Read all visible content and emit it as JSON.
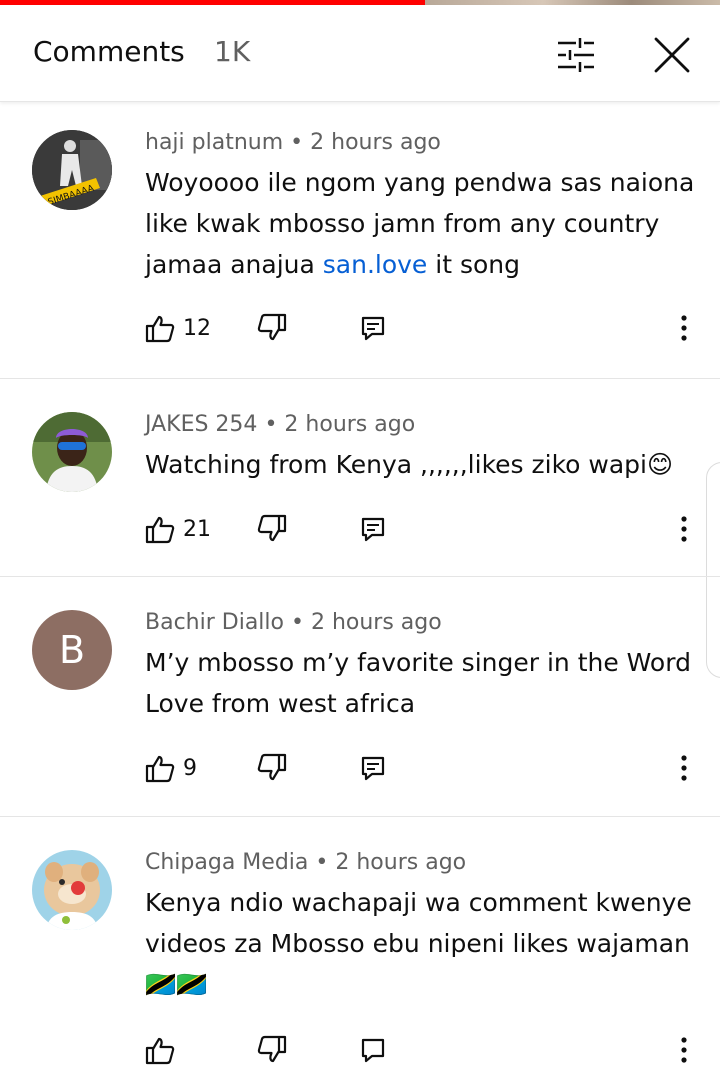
{
  "header": {
    "title": "Comments",
    "count": "1K"
  },
  "comments": [
    {
      "author": "haji platnum",
      "time": "2 hours ago",
      "text_before": "Woyoooo ile ngom yang pendwa sas naiona like kwak mbosso jamn from any country jamaa anajua ",
      "link": "san.love",
      "text_after": " it song",
      "likes": "12",
      "avatar_text": "SIMBAAAA"
    },
    {
      "author": "JAKES 254",
      "time": "2 hours ago",
      "text": "Watching from Kenya ,,,,,,likes ziko wapi😊",
      "likes": "21"
    },
    {
      "author": "Bachir Diallo",
      "time": "2 hours ago",
      "text": "M’y mbosso m’y favorite singer in the Word Love from west africa",
      "likes": "9",
      "avatar_letter": "B"
    },
    {
      "author": "Chipaga Media",
      "time": "2 hours ago",
      "text": "Kenya ndio wachapaji wa comment kwenye videos za Mbosso ebu nipeni likes wajaman 🇹🇿🇹🇿",
      "likes": ""
    }
  ],
  "colors": {
    "accent": "#ff0000",
    "link": "#065fd4",
    "avatar_b": "#8d6e63"
  },
  "icons": [
    "filter-icon",
    "close-icon",
    "thumb-up-icon",
    "thumb-down-icon",
    "reply-icon",
    "more-vert-icon"
  ]
}
